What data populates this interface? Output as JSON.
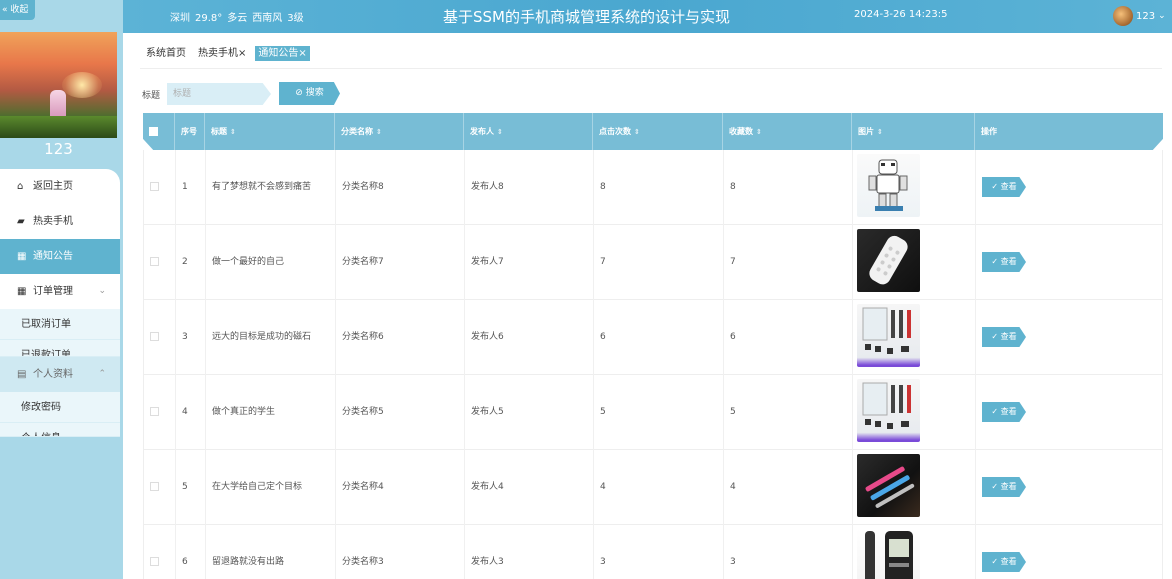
{
  "sidebar": {
    "collapse_label": "« 收起",
    "username": "123",
    "menu": [
      {
        "label": "返回主页",
        "icon": "home-icon"
      },
      {
        "label": "热卖手机",
        "icon": "bag-icon"
      },
      {
        "label": "通知公告",
        "icon": "grid-icon",
        "active": true
      },
      {
        "label": "订单管理",
        "icon": "apps-icon",
        "chevron": "⌄"
      }
    ],
    "order_sub": [
      "已取消订单",
      "已退款订单"
    ],
    "profile_group": {
      "label": "个人资料",
      "icon": "calendar-icon",
      "chevron": "⌃"
    },
    "profile_sub": [
      "修改密码",
      "个人信息"
    ]
  },
  "header": {
    "weather": [
      "深圳",
      "29.8°",
      "多云",
      "西南风",
      "3级"
    ],
    "title": "基于SSM的手机商城管理系统的设计与实现",
    "datetime": "2024-3-26 14:23:5",
    "username": "123",
    "chevron": "⌄"
  },
  "tabs": [
    {
      "label": "系统首页"
    },
    {
      "label": "热卖手机×"
    },
    {
      "label": "通知公告×",
      "active": true
    }
  ],
  "search": {
    "label": "标题",
    "placeholder": "标题",
    "button_label": "⊘ 搜索"
  },
  "table": {
    "headers": {
      "no": "序号",
      "title": "标题",
      "category": "分类名称",
      "publisher": "发布人",
      "clicks": "点击次数",
      "favorites": "收藏数",
      "image": "图片",
      "action": "操作"
    },
    "sort_glyph": "⇕",
    "view_label": "✓ 查看",
    "rows": [
      {
        "no": "1",
        "title": "有了梦想就不会感到痛苦",
        "category": "分类名称8",
        "publisher": "发布人8",
        "clicks": "8",
        "favorites": "8",
        "image": "robot-toy"
      },
      {
        "no": "2",
        "title": "做一个最好的自己",
        "category": "分类名称7",
        "publisher": "发布人7",
        "clicks": "7",
        "favorites": "7",
        "image": "remote-keypad"
      },
      {
        "no": "3",
        "title": "远大的目标是成功的磁石",
        "category": "分类名称6",
        "publisher": "发布人6",
        "clicks": "6",
        "favorites": "6",
        "image": "electronic-kit"
      },
      {
        "no": "4",
        "title": "做个真正的学生",
        "category": "分类名称5",
        "publisher": "发布人5",
        "clicks": "5",
        "favorites": "5",
        "image": "electronic-kit"
      },
      {
        "no": "5",
        "title": "在大学给自己定个目标",
        "category": "分类名称4",
        "publisher": "发布人4",
        "clicks": "4",
        "favorites": "4",
        "image": "usb-pens"
      },
      {
        "no": "6",
        "title": "留退路就没有出路",
        "category": "分类名称3",
        "publisher": "发布人3",
        "clicks": "3",
        "favorites": "3",
        "image": "glucose-meter"
      }
    ]
  },
  "colors": {
    "accent": "#5fb3cf",
    "header_bg": "#4aa7d0",
    "sidebar_bg": "#a9d8e8",
    "table_header_bg": "#78bdd6"
  }
}
